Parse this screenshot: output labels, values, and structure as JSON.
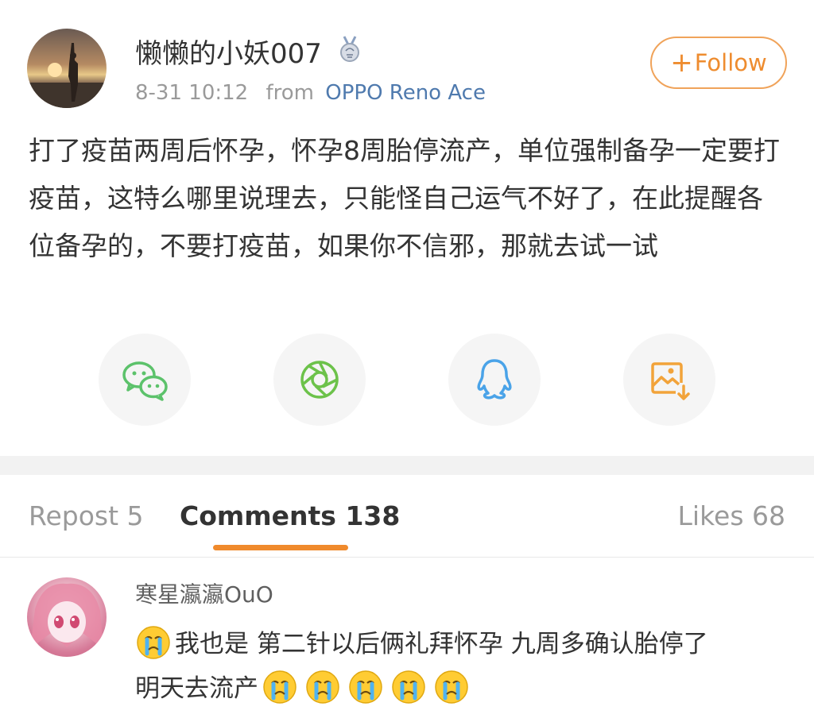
{
  "post": {
    "username": "懒懒的小妖007",
    "timestamp": "8-31 10:12",
    "from_label": "from",
    "device": "OPPO Reno Ace",
    "follow_label": "Follow",
    "content": "打了疫苗两周后怀孕，怀孕8周胎停流产，单位强制备孕一定要打疫苗，这特么哪里说理去，只能怪自己运气不好了，在此提醒各位备孕的，不要打疫苗，如果你不信邪，那就去试一试"
  },
  "share_buttons": [
    {
      "name": "wechat",
      "icon": "wechat-icon",
      "color": "#5cc26b"
    },
    {
      "name": "moments",
      "icon": "moments-icon",
      "color": "#6cc24a"
    },
    {
      "name": "qq",
      "icon": "qq-icon",
      "color": "#4aa3e8"
    },
    {
      "name": "save-image",
      "icon": "save-image-icon",
      "color": "#f2a33a"
    }
  ],
  "tabs": {
    "repost": "Repost 5",
    "comments": "Comments 138",
    "likes": "Likes 68"
  },
  "comment": {
    "username": "寒星瀛瀛OuO",
    "text_line1": "我也是 第二针以后俩礼拜怀孕 九周多确认胎停了",
    "text_line2": "明天去流产",
    "emoji": "crying-face-emoji"
  },
  "colors": {
    "accent": "#f08a2c",
    "link": "#4f7aae",
    "muted": "#9a9a9a"
  }
}
